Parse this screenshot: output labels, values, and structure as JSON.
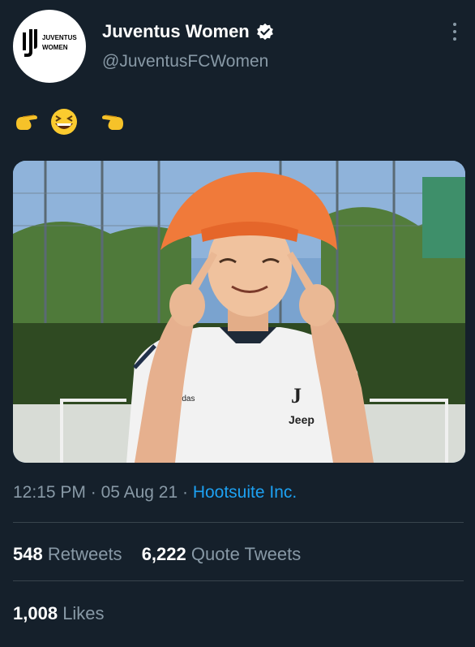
{
  "account": {
    "display_name": "Juventus Women",
    "handle": "@JuventusFCWomen",
    "verified": true,
    "avatar_text_line1": "JUVENTUS",
    "avatar_text_line2": "WOMEN",
    "avatar_icon": "juventus-logo"
  },
  "tweet": {
    "text_emoji": "👉😆👈",
    "media_description_icon": "photo",
    "shirt_brand": "adidas",
    "shirt_sponsor": "Jeep"
  },
  "meta": {
    "time": "12:15 PM",
    "separator1": " · ",
    "date": "05 Aug 21",
    "separator2": " · ",
    "source": "Hootsuite Inc."
  },
  "stats": {
    "retweets_count": "548",
    "retweets_label": "Retweets",
    "quotes_count": "6,222",
    "quotes_label": "Quote Tweets",
    "likes_count": "1,008",
    "likes_label": "Likes"
  },
  "colors": {
    "background": "#15202b",
    "secondary_text": "#8899a6",
    "link": "#1da1f2",
    "divider": "#38444d"
  }
}
